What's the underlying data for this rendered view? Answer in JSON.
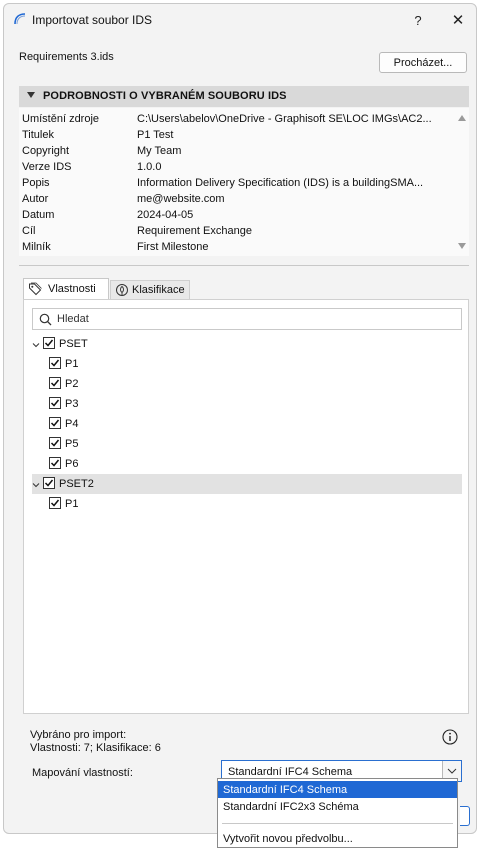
{
  "window": {
    "title": "Importovat soubor IDS",
    "help_label": "?",
    "close_label": "✕"
  },
  "file": {
    "name": "Requirements 3.ids",
    "browse_label": "Procházet..."
  },
  "details": {
    "header": "PODROBNOSTI O VYBRANÉM SOUBORU IDS",
    "rows": [
      {
        "label": "Umístění zdroje",
        "value": "C:\\Users\\abelov\\OneDrive - Graphisoft SE\\LOC IMGs\\AC2..."
      },
      {
        "label": "Titulek",
        "value": "P1 Test"
      },
      {
        "label": "Copyright",
        "value": "My Team"
      },
      {
        "label": "Verze IDS",
        "value": "1.0.0"
      },
      {
        "label": "Popis",
        "value": "Information Delivery Specification (IDS) is a buildingSMA..."
      },
      {
        "label": "Autor",
        "value": "me@website.com"
      },
      {
        "label": "Datum",
        "value": "2024-04-05"
      },
      {
        "label": "Cíl",
        "value": "Requirement Exchange"
      },
      {
        "label": "Milník",
        "value": "First Milestone"
      }
    ]
  },
  "tabs": [
    {
      "label": "Vlastnosti",
      "icon": "tag-icon",
      "active": true
    },
    {
      "label": "Klasifikace",
      "icon": "classification-icon",
      "active": false
    }
  ],
  "search": {
    "placeholder": "Hledat",
    "value": ""
  },
  "tree": [
    {
      "label": "PSET",
      "checked": true,
      "expanded": true,
      "selected": false,
      "children": [
        {
          "label": "P1",
          "checked": true
        },
        {
          "label": "P2",
          "checked": true
        },
        {
          "label": "P3",
          "checked": true
        },
        {
          "label": "P4",
          "checked": true
        },
        {
          "label": "P5",
          "checked": true
        },
        {
          "label": "P6",
          "checked": true
        }
      ]
    },
    {
      "label": "PSET2",
      "checked": true,
      "expanded": true,
      "selected": true,
      "children": [
        {
          "label": "P1",
          "checked": true
        }
      ]
    }
  ],
  "summary": {
    "line1": "Vybráno pro import:",
    "line2": "Vlastnosti: 7; Klasifikace: 6"
  },
  "mapping": {
    "label": "Mapování vlastností:",
    "selected": "Standardní IFC4 Schema",
    "options": [
      {
        "label": "Standardní IFC4 Schema",
        "highlighted": true
      },
      {
        "label": "Standardní IFC2x3 Schéma",
        "highlighted": false
      },
      {
        "label": "Vytvořit novou předvolbu...",
        "highlighted": false
      }
    ]
  },
  "colors": {
    "accent": "#1f68d4",
    "section_header_bg": "#d9d9d9",
    "selected_row_bg": "#e2e2e2"
  }
}
